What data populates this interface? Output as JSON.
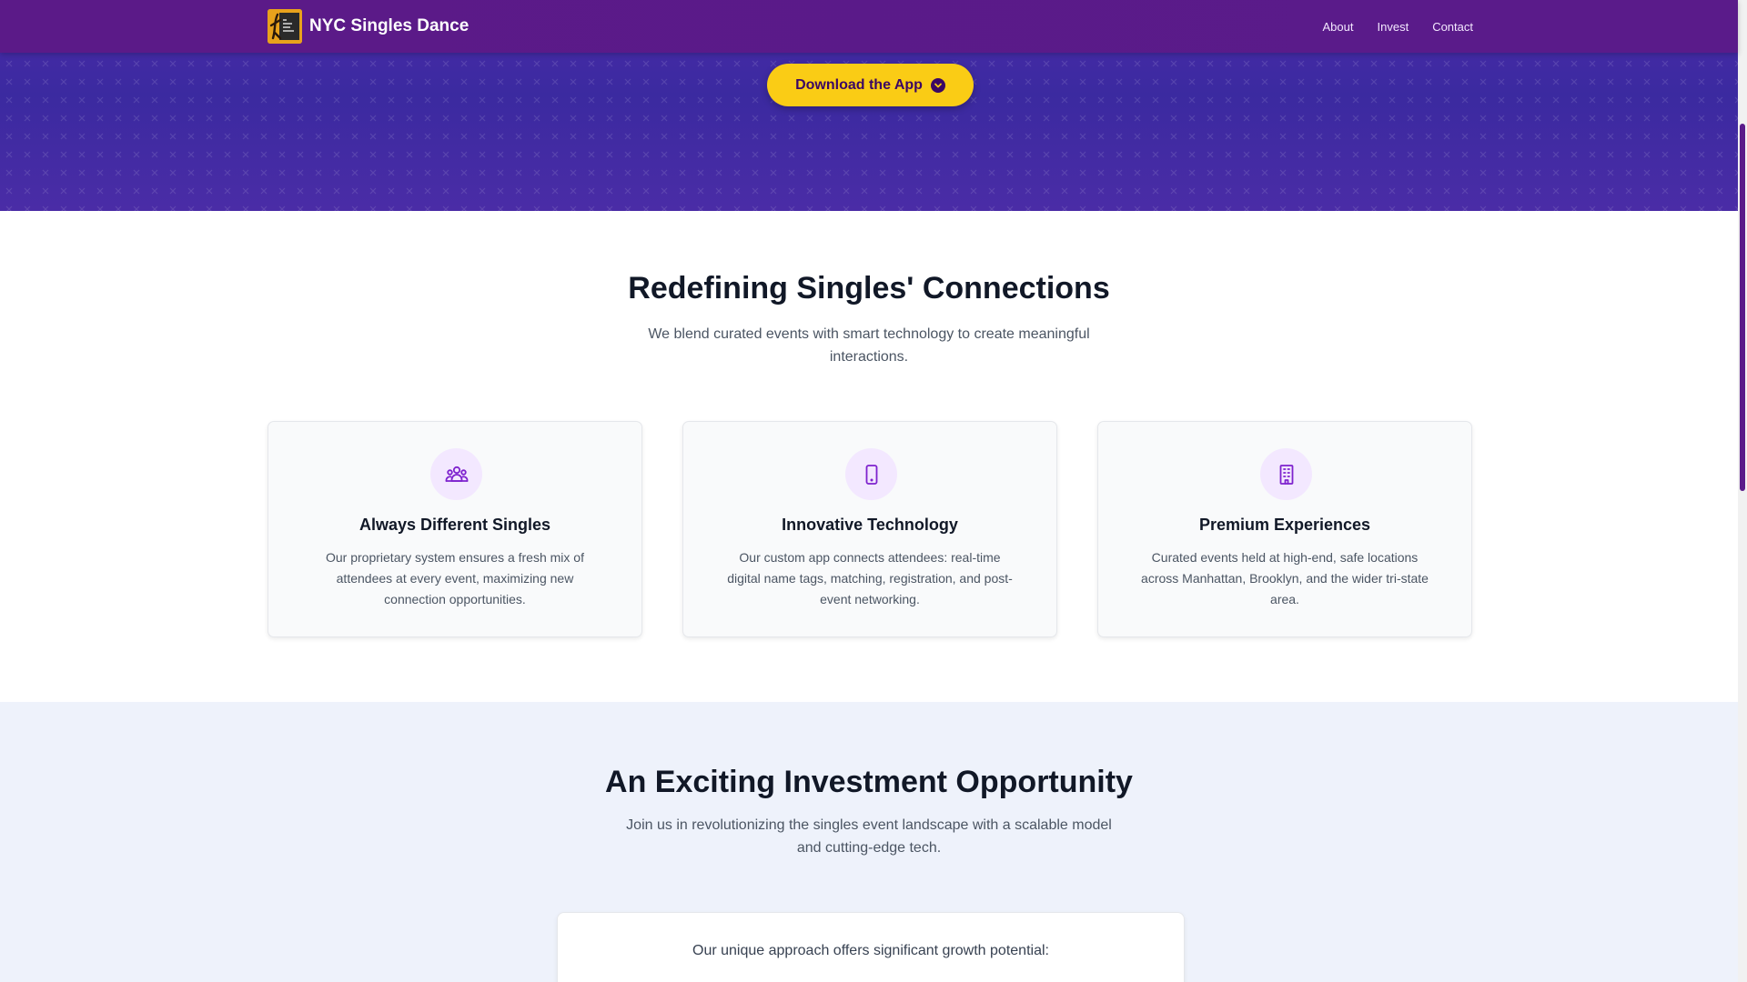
{
  "nav": {
    "brand": "NYC Singles Dance",
    "links": [
      "About",
      "Invest",
      "Contact"
    ]
  },
  "hero": {
    "cta_label": "Download the App",
    "cta_icon": "chevron-down-circle-icon"
  },
  "features": {
    "title": "Redefining Singles' Connections",
    "subtitle_line1": "We blend curated events with smart technology to create meaningful",
    "subtitle_line2": "interactions.",
    "cards": [
      {
        "icon": "people-group-icon",
        "title": "Always Different Singles",
        "text": "Our proprietary system ensures a fresh mix of attendees at every event, maximizing new connection opportunities."
      },
      {
        "icon": "smartphone-icon",
        "title": "Innovative Technology",
        "text": "Our custom app connects attendees: real-time digital name tags, matching, registration, and post-event networking."
      },
      {
        "icon": "building-icon",
        "title": "Premium Experiences",
        "text": "Curated events held at high-end, safe locations across Manhattan, Brooklyn, and the wider tri-state area."
      }
    ]
  },
  "invest": {
    "title": "An Exciting Investment Opportunity",
    "subtitle_line1": "Join us in revolutionizing the singles event landscape with a scalable model",
    "subtitle_line2": "and cutting-edge tech.",
    "box_text": "Our unique approach offers significant growth potential:"
  },
  "colors": {
    "nav_bg": "#5a1b8a",
    "hero_bg": "#3b2aa0",
    "cta_bg": "#facc15",
    "accent": "#7e22ce",
    "invest_bg": "#eef2fb"
  }
}
